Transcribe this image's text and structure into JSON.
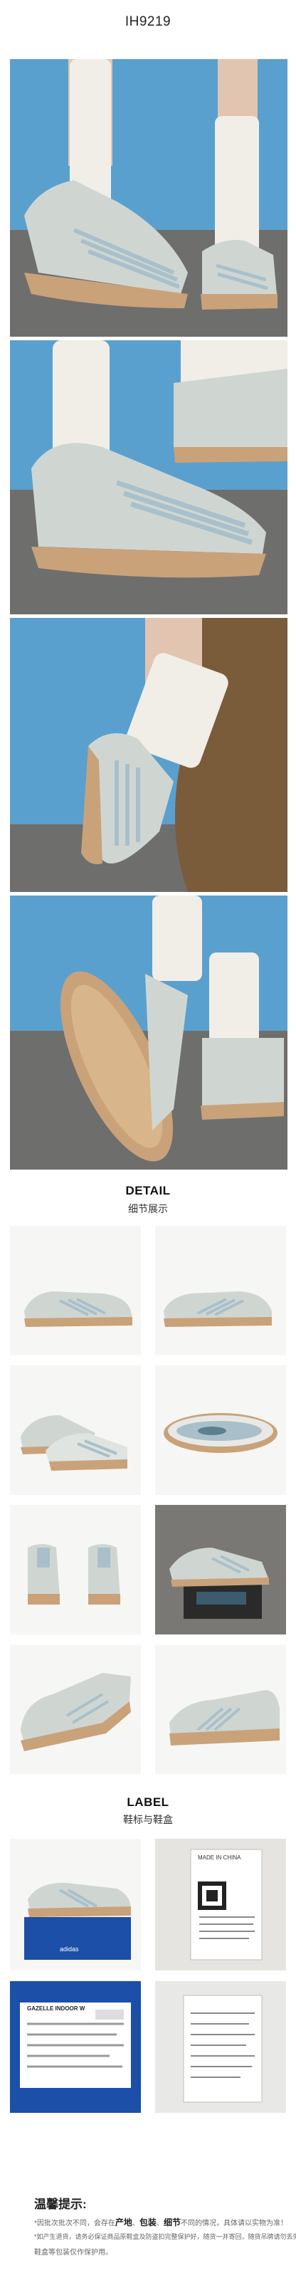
{
  "product": {
    "code": "IH9219"
  },
  "detail_section": {
    "title": "DETAIL",
    "subtitle": "细节展示"
  },
  "label_section": {
    "title": "LABEL",
    "subtitle": "鞋标与鞋盒"
  },
  "tips": {
    "title": "温馨提示:",
    "line1_prefix": "*因批次批次不同，会存在",
    "line1_k1": "产地",
    "line1_sep1": "、",
    "line1_k2": "包装",
    "line1_sep2": "、",
    "line1_k3": "细节",
    "line1_suffix": "不同的情况，具体请以实物为准！",
    "line2": "*如产生退货，请务必保证商品原鞋盒及防盗扣完整保护好，随货一并寄回，随货吊牌请勿丢失。",
    "line3": "鞋盒等包装仅作保护用。"
  },
  "box_label": {
    "brand_text": "adidas",
    "model_text": "GAZELLE INDOOR W"
  },
  "tag_label": {
    "made_in": "MADE IN CHINA"
  },
  "colors": {
    "shoe_upper": "#cfd6d2",
    "stripes": "#a9c0cb",
    "sole": "#c9a27a",
    "sock": "#f1eee8",
    "sky": "#5aa0cf",
    "ground": "#6e6e6c",
    "box_blue": "#1b4fa8"
  }
}
